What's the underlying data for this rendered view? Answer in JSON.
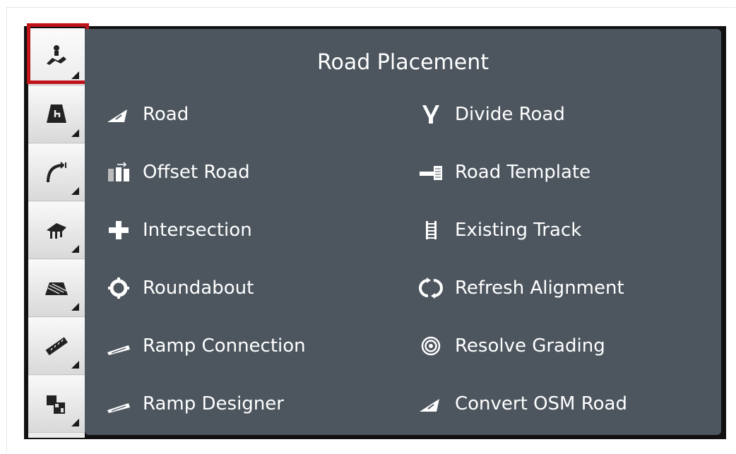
{
  "panel": {
    "title": "Road Placement",
    "items": [
      {
        "label": "Road",
        "icon": "road-icon"
      },
      {
        "label": "Divide Road",
        "icon": "divide-road-icon"
      },
      {
        "label": "Offset Road",
        "icon": "offset-road-icon"
      },
      {
        "label": "Road Template",
        "icon": "road-template-icon"
      },
      {
        "label": "Intersection",
        "icon": "intersection-icon"
      },
      {
        "label": "Existing Track",
        "icon": "existing-track-icon"
      },
      {
        "label": "Roundabout",
        "icon": "roundabout-icon"
      },
      {
        "label": "Refresh Alignment",
        "icon": "refresh-alignment-icon"
      },
      {
        "label": "Ramp Connection",
        "icon": "ramp-connection-icon"
      },
      {
        "label": "Resolve Grading",
        "icon": "resolve-grading-icon"
      },
      {
        "label": "Ramp Designer",
        "icon": "ramp-designer-icon"
      },
      {
        "label": "Convert OSM Road",
        "icon": "convert-osm-road-icon"
      }
    ]
  },
  "toolbar": {
    "tools": [
      {
        "icon": "road-placement-tool-icon",
        "selected": true
      },
      {
        "icon": "terrain-tool-icon"
      },
      {
        "icon": "curve-tool-icon"
      },
      {
        "icon": "structure-tool-icon"
      },
      {
        "icon": "surface-tool-icon"
      },
      {
        "icon": "measure-tool-icon"
      },
      {
        "icon": "objects-tool-icon"
      }
    ]
  },
  "colors": {
    "panel_bg": "#4d565f",
    "selection": "#c0141b"
  }
}
